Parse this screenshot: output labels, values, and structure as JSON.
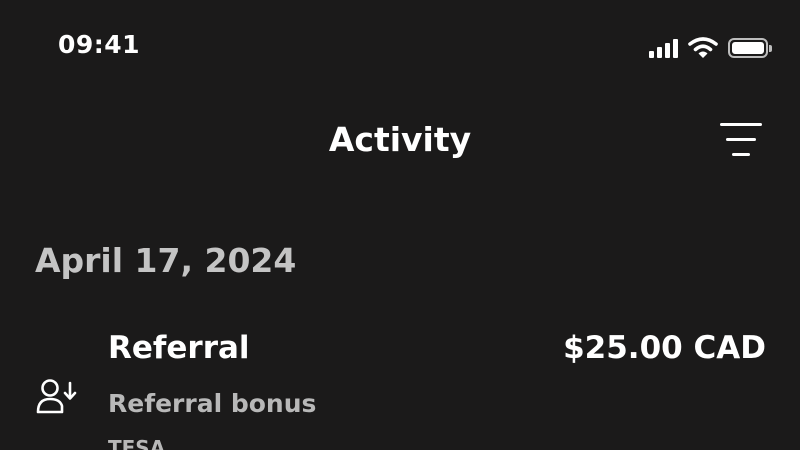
{
  "status_bar": {
    "time": "09:41",
    "icons": [
      "cellular-signal-icon",
      "wifi-icon",
      "battery-icon"
    ]
  },
  "header": {
    "title": "Activity",
    "filter_icon": "filter-icon"
  },
  "activity": {
    "date": "April 17, 2024",
    "items": [
      {
        "title": "Referral",
        "amount": "$25.00 CAD",
        "subtitle": "Referral bonus",
        "meta": "TFSA",
        "icon": "user-download-icon"
      }
    ]
  },
  "colors": {
    "background": "#1b1a1a",
    "primary_text": "#ffffff",
    "secondary_text": "#b8b8b8"
  }
}
